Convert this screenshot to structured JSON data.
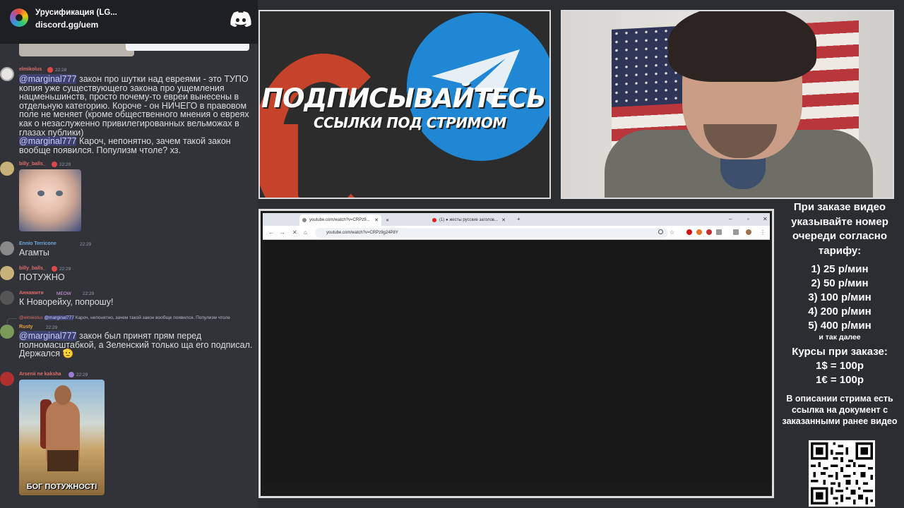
{
  "server": {
    "name": "Урусификация (LG...",
    "invite": "discord.gg/uem"
  },
  "messages": [
    {
      "user": "elmikolus",
      "time": "22:28",
      "user_color": "#e06c6c",
      "mention1": "@marginal777",
      "text1": " закон про шутки над евреями - это ТУПО копия уже существующего закона про ущемления нацменьшинств, просто почему-то евреи вынесены в отдельную категорию. Короче - он НИЧЕГО в правовом поле не меняет (кроме общественного мнения о евреях как о незаслуженно привилегированных вельможах в глазах публики)",
      "mention2": "@marginal777",
      "text2": " Кароч, непонятно, зачем такой закон вообще появился. Популизм чтоле? хз."
    },
    {
      "user": "billy_balls_",
      "time": "22:29",
      "user_color": "#e06c6c"
    },
    {
      "user": "Ennio Terricone",
      "time": "22:29",
      "user_color": "#6fa8dc",
      "text": "Агамты"
    },
    {
      "user": "billy_balls_",
      "time": "22:29",
      "user_color": "#e06c6c",
      "text": "ПОТУЖНО"
    },
    {
      "user": "Аннамити",
      "time": "22:29",
      "user_color": "#e06c6c",
      "tag": "MEOW",
      "text": "К Новорейху, попрошу!"
    },
    {
      "reply_user": "@elmikolus",
      "reply_mention": "@marginal777",
      "reply_text": " Кароч, непонятно, зачем такой закон вообще появился. Популизм чтоле",
      "user": "Rusty",
      "time": "22:29",
      "user_color": "#e8a33c",
      "mention": "@marginal777",
      "text": " закон был принят прям перед полномасштабкой, а Зеленский только ща его подписал. Держался"
    },
    {
      "user": "Arsenii ne kaksha",
      "time": "22:29",
      "user_color": "#e06c6c",
      "image_caption": "БОГ ПОТУЖНОСТІ"
    }
  ],
  "promo": {
    "title": "ПОДПИСЫВАЙТЕСЬ",
    "subtitle": "ССЫЛКИ ПОД СТРИМОМ"
  },
  "browser": {
    "tab1": "youtube.com/watch?v=CRPz9...",
    "tab2": "(1) ● жесты русские заголов...",
    "url": "youtube.com/watch?v=CRPz9g24P8Y"
  },
  "info": {
    "order_note": "При заказе видео указывайте номер очереди согласно тарифу:",
    "prices": [
      "1) 25 р/мин",
      "2) 50 р/мин",
      "3) 100 р/мин",
      "4) 200 р/мин",
      "5) 400 р/мин"
    ],
    "etc": "и так далее",
    "rates_title": "Курсы при заказе:",
    "rate_usd": "1$ = 100р",
    "rate_eur": "1€ = 100р",
    "doc_note": "В описании стрима есть ссылка на документ с заказанными ранее видео"
  },
  "colors": {
    "discord_bg": "#313338",
    "mention_bg": "#3c4270",
    "promo_blue": "#1f87d3",
    "promo_red": "#c6432b"
  }
}
